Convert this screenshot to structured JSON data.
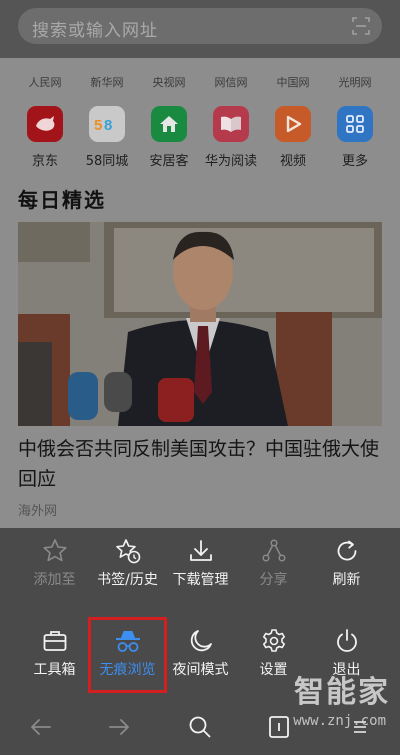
{
  "search": {
    "placeholder": "搜索或输入网址"
  },
  "quick_links": [
    "人民网",
    "新华网",
    "央视网",
    "网信网",
    "中国网",
    "光明网"
  ],
  "apps": [
    {
      "label": "京东",
      "icon": "jd-dog-icon",
      "color": "#c8161e"
    },
    {
      "label": "58同城",
      "icon": "58-logo-icon",
      "color": "#f3f3f3"
    },
    {
      "label": "安居客",
      "icon": "house-icon",
      "color": "#1fa14b"
    },
    {
      "label": "华为阅读",
      "icon": "book-icon",
      "color": "#e0405a"
    },
    {
      "label": "视频",
      "icon": "play-icon",
      "color": "#f26b2d"
    },
    {
      "label": "更多",
      "icon": "grid-icon",
      "color": "#3b8ff1"
    }
  ],
  "section_title": "每日精选",
  "article": {
    "headline": "中俄会否共同反制美国攻击？中国驻俄大使回应",
    "source": "海外网"
  },
  "menu": {
    "row1": [
      {
        "label": "添加至",
        "icon": "star-icon",
        "enabled": false
      },
      {
        "label": "书签/历史",
        "icon": "bookmark-history-icon",
        "enabled": true
      },
      {
        "label": "下载管理",
        "icon": "download-icon",
        "enabled": true
      },
      {
        "label": "分享",
        "icon": "share-icon",
        "enabled": false
      },
      {
        "label": "刷新",
        "icon": "refresh-icon",
        "enabled": true
      }
    ],
    "row2": [
      {
        "label": "工具箱",
        "icon": "toolbox-icon",
        "enabled": true
      },
      {
        "label": "无痕浏览",
        "icon": "incognito-icon",
        "enabled": true,
        "highlighted": true
      },
      {
        "label": "夜间模式",
        "icon": "moon-icon",
        "enabled": true
      },
      {
        "label": "设置",
        "icon": "gear-icon",
        "enabled": true
      },
      {
        "label": "退出",
        "icon": "power-icon",
        "enabled": true
      }
    ]
  },
  "watermark": {
    "text": "智能家",
    "url": "www.znj.com"
  },
  "colors": {
    "highlight_border": "#d31f1f",
    "highlight_text": "#3d8ef0"
  }
}
